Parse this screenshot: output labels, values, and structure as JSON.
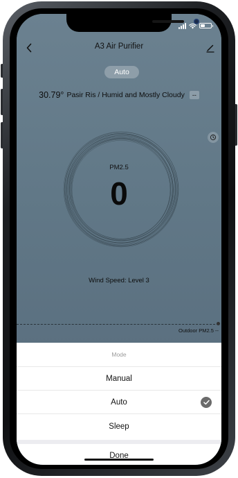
{
  "header": {
    "title": "A3 Air Purifier"
  },
  "mode_pill": "Auto",
  "weather": {
    "temperature": "30.79°",
    "description": "Pasir Ris / Humid and Mostly Cloudy",
    "extra": "--"
  },
  "dial": {
    "label": "PM2.5",
    "value": "0"
  },
  "wind_speed": "Wind Speed: Level 3",
  "outdoor": {
    "label": "Outdoor PM2.5 --"
  },
  "mode_sheet": {
    "title": "Mode",
    "options": [
      "Manual",
      "Auto",
      "Sleep"
    ],
    "selected": "Auto",
    "done_label": "Done"
  },
  "colors": {
    "background": "#617887",
    "sheet": "#ffffff",
    "check": "#6b6b6b"
  },
  "icons": {
    "back": "chevron-left-icon",
    "edit": "pencil-icon",
    "timer": "clock-icon",
    "check": "check-circle-icon"
  }
}
